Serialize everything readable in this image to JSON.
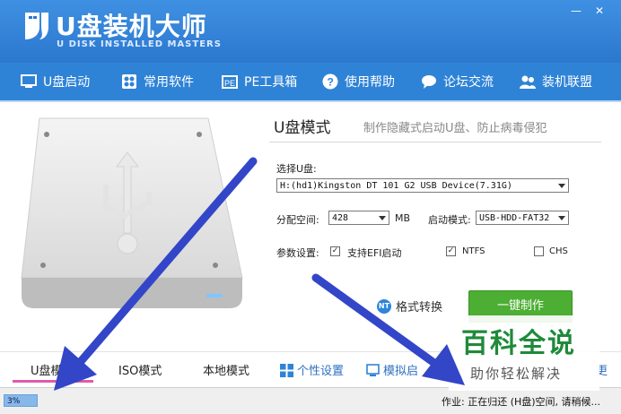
{
  "window": {
    "title": "U盘装机大师",
    "subtitle": "U DISK INSTALLED MASTERS",
    "controls": [
      "—",
      "✕"
    ]
  },
  "nav": [
    {
      "label": "U盘启动",
      "icon": "monitor-icon"
    },
    {
      "label": "常用软件",
      "icon": "apps-icon"
    },
    {
      "label": "PE工具箱",
      "icon": "pe-toolbox-icon"
    },
    {
      "label": "使用帮助",
      "icon": "help-icon"
    },
    {
      "label": "论坛交流",
      "icon": "chat-icon"
    },
    {
      "label": "装机联盟",
      "icon": "users-icon"
    }
  ],
  "main": {
    "mode_title": "U盘模式",
    "mode_desc": "制作隐藏式启动U盘、防止病毒侵犯",
    "select_udisk_label": "选择U盘:",
    "select_udisk_value": "H:(hd1)Kingston DT 101 G2 USB Device(7.31G)",
    "partition_label": "分配空间:",
    "partition_value": "428",
    "partition_unit": "MB",
    "boot_mode_label": "启动模式:",
    "boot_mode_value": "USB-HDD-FAT32",
    "params_label": "参数设置:",
    "opt_efi": "支持EFI启动",
    "opt_ntfs": "NTFS",
    "opt_chs": "CHS",
    "format_convert": "格式转换",
    "make_button": "一键制作"
  },
  "tabs": {
    "udisk": "U盘模式",
    "iso": "ISO模式",
    "local": "本地模式",
    "personal": "个性设置",
    "simulate": "模拟启",
    "extra": "更"
  },
  "status": {
    "progress_label": "3%",
    "progress_value": 0.03,
    "text": "作业: 正在归还 (H盘)空间, 请稍候..."
  },
  "watermark": {
    "title": "百科全说",
    "subtitle": "助你轻松解决"
  },
  "colors": {
    "titlebar": "#3a8ade",
    "navbar": "#2f83d6",
    "make_button": "#4cae33",
    "arrow": "#3346c8",
    "tab_underline": "#e05aa8"
  }
}
